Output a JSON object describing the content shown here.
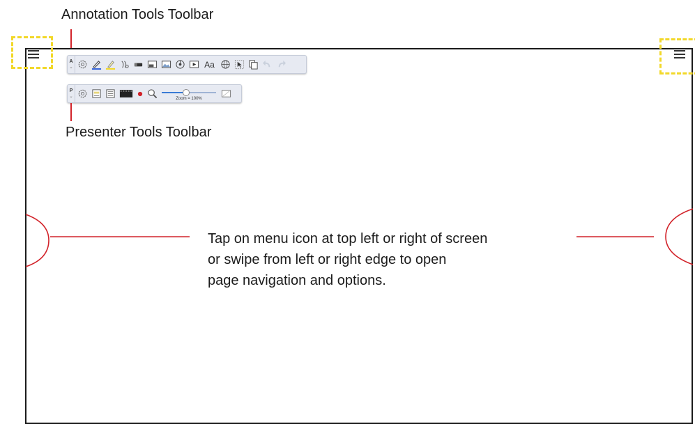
{
  "labels": {
    "annotation_toolbar": "Annotation Tools Toolbar",
    "presenter_toolbar": "Presenter Tools Toolbar"
  },
  "annotation_toolbar": {
    "handle_label": "A",
    "aa_label": "Aa",
    "tools": [
      "settings-gear-icon",
      "pen-icon",
      "highlighter-icon",
      "stamp-icon",
      "eraser-icon",
      "image-insert-icon",
      "picture-icon",
      "audio-icon",
      "video-icon",
      "text-tool",
      "globe-icon",
      "select-icon",
      "copy-icon",
      "undo-icon",
      "redo-icon"
    ]
  },
  "presenter_toolbar": {
    "handle_label": "P",
    "zoom_label": "Zoom = 100%",
    "zoom_value": 0.45,
    "tools": [
      "settings-gear-icon",
      "file-icon",
      "slides-icon",
      "film-strip-icon",
      "record-dot",
      "magnifier-icon",
      "zoom-slider",
      "fullscreen-icon"
    ]
  },
  "instructions": {
    "line1": "Tap on menu icon at top left or right of screen",
    "line2": "or swipe from left or right edge to open",
    "line3": "page navigation and options."
  },
  "colors": {
    "accent_callout": "#d2232a",
    "highlight_dashed": "#f2d829",
    "toolbar_bg": "#e7eaf2"
  }
}
